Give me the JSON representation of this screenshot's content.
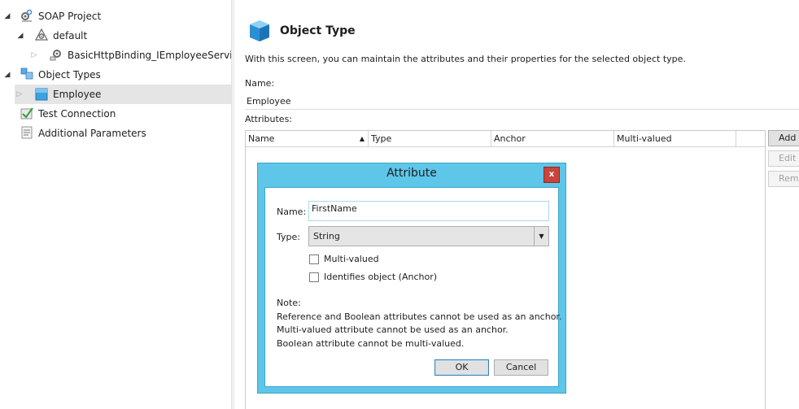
{
  "tree": {
    "items": [
      {
        "label": "SOAP Project",
        "icon": "project-gear-icon",
        "expander": "expanded"
      },
      {
        "label": "default",
        "icon": "shared-gear-icon",
        "expander": "expanded"
      },
      {
        "label": "BasicHttpBinding_IEmployeeService",
        "icon": "binding-gear-icon",
        "expander": "collapsed"
      },
      {
        "label": "Object Types",
        "icon": "object-types-icon",
        "expander": "expanded"
      },
      {
        "label": "Employee",
        "icon": "object-cube-icon",
        "expander": "collapsed",
        "selected": true
      },
      {
        "label": "Test Connection",
        "icon": "test-connection-icon"
      },
      {
        "label": "Additional Parameters",
        "icon": "parameters-icon"
      }
    ]
  },
  "content": {
    "title": "Object Type",
    "description": "With this screen, you can maintain the attributes and their properties for the selected object type.",
    "name_label": "Name:",
    "name_value": "Employee",
    "attributes_label": "Attributes:",
    "columns": [
      "Name",
      "Type",
      "Anchor",
      "Multi-valued"
    ],
    "sorted_column": "Name",
    "sort_direction": "ascending",
    "side_buttons": {
      "add": "Add",
      "edit": "Edit",
      "remove": "Remove"
    }
  },
  "dialog": {
    "title": "Attribute",
    "close_symbol": "x",
    "name_label": "Name:",
    "name_value": "FirstName",
    "type_label": "Type:",
    "type_value": "String",
    "multi_valued_label": "Multi-valued",
    "multi_valued_checked": false,
    "anchor_label": "Identifies object (Anchor)",
    "anchor_checked": false,
    "note_heading": "Note:",
    "note_lines": [
      "Reference and Boolean attributes cannot be used as an anchor.",
      "Multi-valued attribute cannot be used as an anchor.",
      "Boolean attribute cannot be multi-valued."
    ],
    "ok_label": "OK",
    "cancel_label": "Cancel"
  },
  "colors": {
    "dialog_chrome": "#5ec6e8",
    "close_button": "#c9443c",
    "selection": "#e5e5e5"
  }
}
